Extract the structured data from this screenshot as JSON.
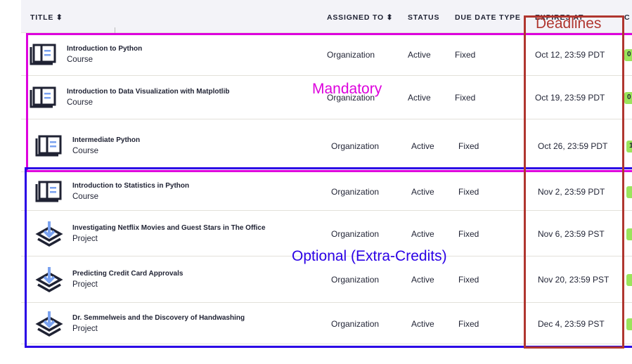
{
  "header": {
    "title": "TITLE ⬍",
    "assigned_to": "ASSIGNED TO ⬍",
    "status": "STATUS",
    "due_date_type": "DUE DATE TYPE",
    "expires_at": "EXPIRES AT",
    "extra": "C"
  },
  "rows": [
    {
      "title": "Introduction to Python",
      "type": "Course",
      "icon": "course-icon",
      "assigned": "Organization",
      "status": "Active",
      "due": "Fixed",
      "expires": "Oct 12, 23:59 PDT",
      "badge": "0"
    },
    {
      "title": "Introduction to Data Visualization with Matplotlib",
      "type": "Course",
      "icon": "course-icon",
      "assigned": "Organization",
      "status": "Active",
      "due": "Fixed",
      "expires": "Oct 19, 23:59 PDT",
      "badge": "0"
    },
    {
      "title": "Intermediate Python",
      "type": "Course",
      "icon": "course-icon",
      "assigned": "Organization",
      "status": "Active",
      "due": "Fixed",
      "expires": "Oct 26, 23:59 PDT",
      "badge": "1"
    },
    {
      "title": "Introduction to Statistics in Python",
      "type": "Course",
      "icon": "course-icon",
      "assigned": "Organization",
      "status": "Active",
      "due": "Fixed",
      "expires": "Nov 2, 23:59 PDT",
      "badge": ""
    },
    {
      "title": "Investigating Netflix Movies and Guest Stars in The Office",
      "type": "Project",
      "icon": "project-icon",
      "assigned": "Organization",
      "status": "Active",
      "due": "Fixed",
      "expires": "Nov 6, 23:59 PST",
      "badge": ""
    },
    {
      "title": "Predicting Credit Card Approvals",
      "type": "Project",
      "icon": "project-icon",
      "assigned": "Organization",
      "status": "Active",
      "due": "Fixed",
      "expires": "Nov 20, 23:59 PST",
      "badge": ""
    },
    {
      "title": "Dr. Semmelweis and the Discovery of Handwashing",
      "type": "Project",
      "icon": "project-icon",
      "assigned": "Organization",
      "status": "Active",
      "due": "Fixed",
      "expires": "Dec 4, 23:59 PST",
      "badge": ""
    }
  ],
  "annotations": {
    "deadlines": "Deadlines",
    "mandatory": "Mandatory",
    "optional": "Optional (Extra-Credits)",
    "colors": {
      "deadlines": "#b0362f",
      "mandatory": "#dd00dd",
      "optional": "#2a00e6"
    }
  }
}
